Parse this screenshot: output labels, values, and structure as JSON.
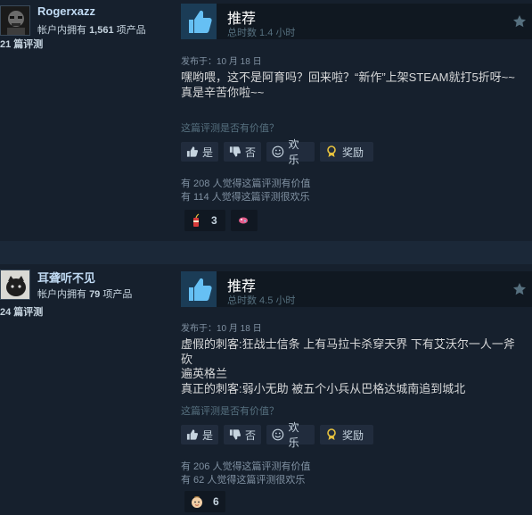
{
  "reviews": [
    {
      "author": {
        "name": "Rogerxazz",
        "owned_prefix": "帐户内拥有",
        "owned_count": "1,561",
        "owned_suffix": "项产品",
        "review_count": "21 篇评测"
      },
      "recommendation": "推荐",
      "hours": "总时数 1.4 小时",
      "posted": "发布于：10 月 18 日",
      "content": "嘿哟喂，这不是阿育吗？回来啦？“新作”上架STEAM就打5折呀~~真是辛苦你啦~~",
      "helpful_question": "这篇评测是否有价值？",
      "buttons": {
        "yes": "是",
        "no": "否",
        "funny": "欢乐",
        "award": "奖励"
      },
      "helpful_stat": "有 208 人觉得这篇评测有价值",
      "funny_stat": "有 114 人觉得这篇评测很欢乐",
      "awards": [
        {
          "icon": "firecracker-award-icon",
          "count": "3"
        },
        {
          "icon": "candy-award-icon",
          "count": ""
        }
      ]
    },
    {
      "author": {
        "name": "耳聋听不见",
        "owned_prefix": "帐户内拥有",
        "owned_count": "79",
        "owned_suffix": "项产品",
        "review_count": "24 篇评测"
      },
      "recommendation": "推荐",
      "hours": "总时数 4.5 小时",
      "posted": "发布于：10 月 18 日",
      "content_lines": [
        "虚假的刺客:狂战士信条 上有马拉卡杀穿天界 下有艾沃尔一人一斧砍",
        "遍英格兰",
        "真正的刺客:弱小无助 被五个小兵从巴格达城南追到城北"
      ],
      "helpful_question": "这篇评测是否有价值？",
      "buttons": {
        "yes": "是",
        "no": "否",
        "funny": "欢乐",
        "award": "奖励"
      },
      "helpful_stat": "有 206 人觉得这篇评测有价值",
      "funny_stat": "有 62 人觉得这篇评测很欢乐",
      "awards": [
        {
          "icon": "baby-face-award-icon",
          "count": "6"
        }
      ]
    }
  ],
  "colors": {
    "page_bg": "#1b2838",
    "card_bg": "#16202d",
    "accent_blue": "#67c1f5",
    "award_gold": "#e8c33e"
  }
}
